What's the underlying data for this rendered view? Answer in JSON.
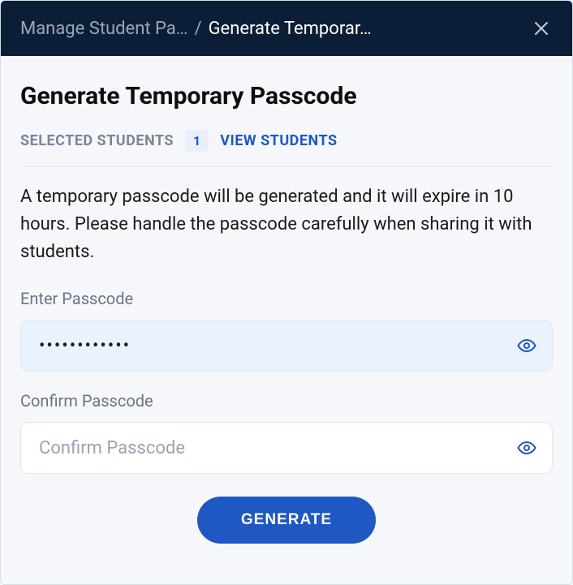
{
  "header": {
    "breadcrumb_prev": "Manage Student Pa…",
    "breadcrumb_sep": "/",
    "breadcrumb_current": "Generate Temporar…"
  },
  "main": {
    "title": "Generate Temporary Passcode",
    "selected_label": "SELECTED STUDENTS",
    "selected_count": "1",
    "view_link": "VIEW STUDENTS",
    "description": "A temporary passcode will be generated and it will expire in 10 hours. Please handle the passcode carefully when sharing it with students."
  },
  "fields": {
    "enter": {
      "label": "Enter Passcode",
      "value": "••••••••••••",
      "placeholder": ""
    },
    "confirm": {
      "label": "Confirm Passcode",
      "value": "",
      "placeholder": "Confirm Passcode"
    }
  },
  "actions": {
    "generate": "GENERATE"
  },
  "icons": {
    "close": "close-icon",
    "eye": "eye-icon"
  }
}
